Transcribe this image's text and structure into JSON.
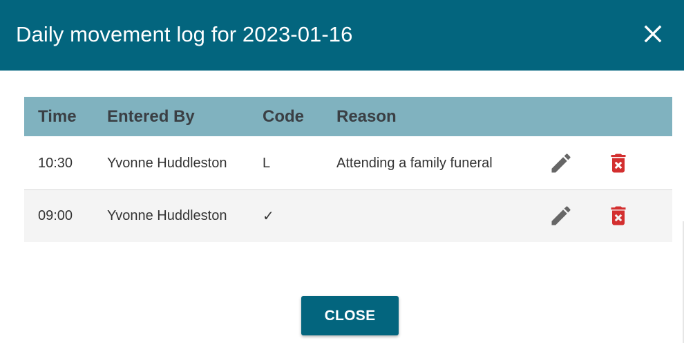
{
  "dialog": {
    "title": "Daily movement log for 2023-01-16",
    "close_icon": "close-icon",
    "header_color": "#03657e"
  },
  "table": {
    "headers": {
      "time": "Time",
      "entered_by": "Entered By",
      "code": "Code",
      "reason": "Reason"
    },
    "header_color": "#80b2bf",
    "rows": [
      {
        "time": "10:30",
        "entered_by": "Yvonne Huddleston",
        "code": "L",
        "reason": "Attending a family funeral",
        "edit_icon": "pencil-icon",
        "delete_icon": "trash-icon"
      },
      {
        "time": "09:00",
        "entered_by": "Yvonne Huddleston",
        "code": "✓",
        "reason": "",
        "edit_icon": "pencil-icon",
        "delete_icon": "trash-icon"
      }
    ]
  },
  "footer": {
    "close_label": "CLOSE"
  },
  "colors": {
    "edit_icon": "#666666",
    "delete_icon": "#d32f2f"
  }
}
